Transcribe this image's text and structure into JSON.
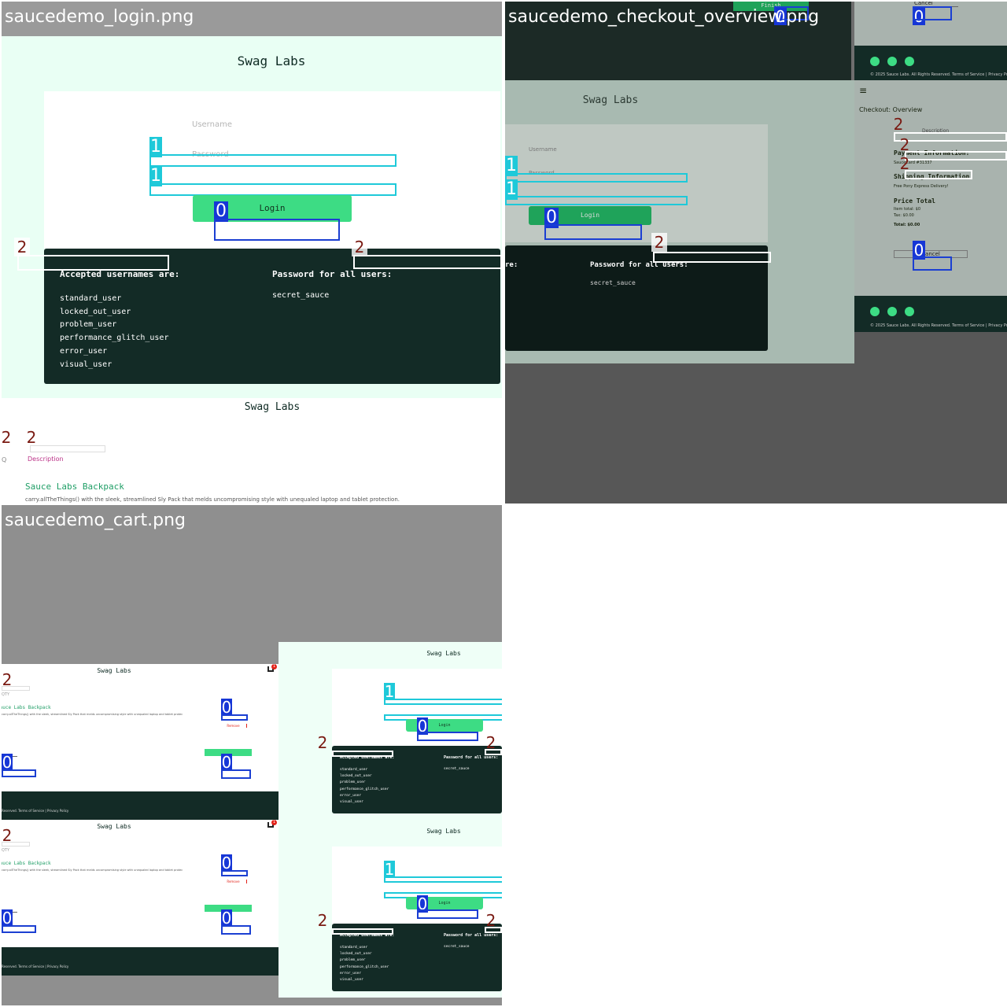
{
  "panels": {
    "login": {
      "title": "saucedemo_login.png"
    },
    "checkout": {
      "title": "saucedemo_checkout_overview.png"
    },
    "cart": {
      "title": "saucedemo_cart.png"
    }
  },
  "brand": "Swag Labs",
  "login_form": {
    "username_placeholder": "Username",
    "password_placeholder": "Password",
    "login_label": "Login"
  },
  "credentials": {
    "usernames_heading": "Accepted usernames are:",
    "usernames": [
      "standard_user",
      "locked_out_user",
      "problem_user",
      "performance_glitch_user",
      "error_user",
      "visual_user"
    ],
    "password_heading": "Password for all users:",
    "password": "secret_sauce"
  },
  "inventory": {
    "description_header": "Description",
    "qty_header": "QTY",
    "product_name": "Sauce Labs Backpack",
    "product_desc": "carry.allTheThings() with the sleek, streamlined Sly Pack that melds uncompromising style with unequaled laptop and tablet protection."
  },
  "checkout": {
    "hamburger": "≡",
    "header": "Checkout: Overview",
    "description_header": "Description",
    "payment_label": "Payment Information:",
    "payment_value": "SauceCard #31337",
    "shipping_label": "Shipping Information:",
    "shipping_value": "Free Pony Express Delivery!",
    "price_label": "Price Total",
    "item_total": "Item total: $0",
    "tax": "Tax: $0.00",
    "total": "Total: $0.00",
    "finish_label": "Finish",
    "cancel_label": "Cancel",
    "footer_text": "© 2025 Sauce Labs. All Rights Reserved. Terms of Service | Privacy Policy"
  },
  "cart": {
    "footer_text": "Reserved. Terms of Service | Privacy Policy",
    "remove_label": "Remove",
    "cart_count": "1"
  },
  "tags": {
    "input": "1",
    "button": "0",
    "text": "2"
  },
  "colors": {
    "accent": "#3ddc84",
    "dark": "#132b26",
    "cyan_box": "#1ec9d9",
    "blue_box": "#1b3fd2",
    "bg_login": "#e6fff3"
  }
}
